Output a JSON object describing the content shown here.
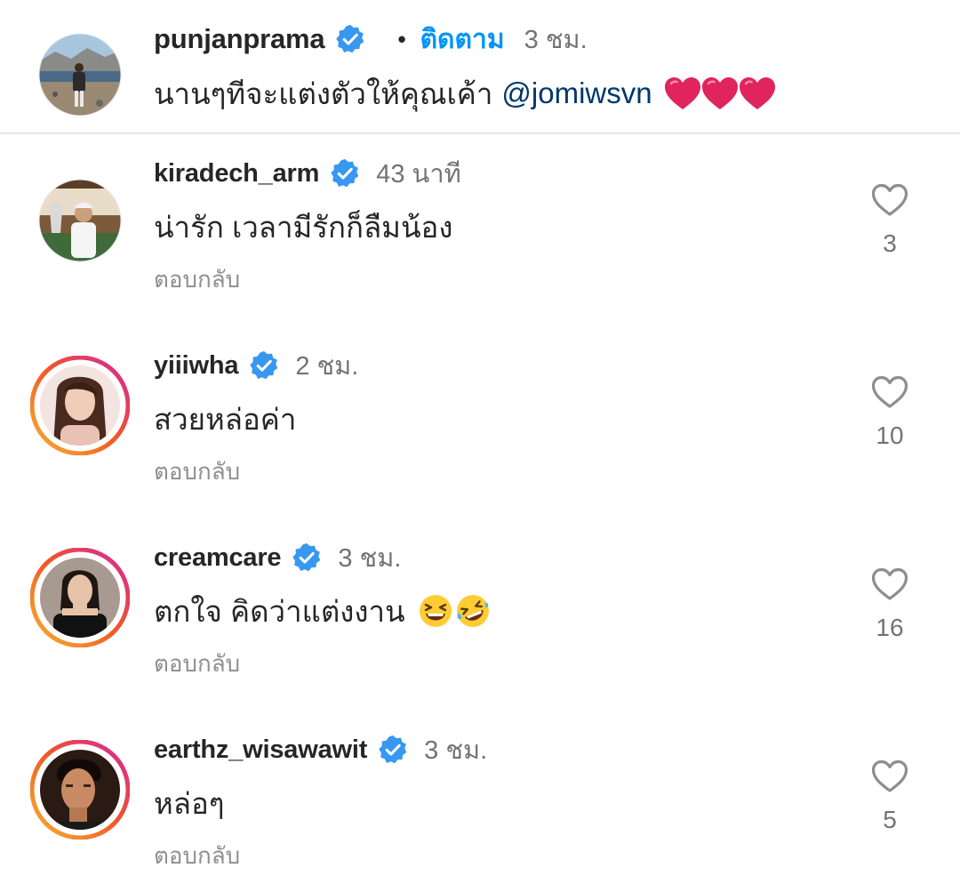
{
  "caption": {
    "username": "punjanprama",
    "dot": "•",
    "follow_label": "ติดตาม",
    "time": "3 ชม.",
    "text": "นานๆทีจะแต่งตัวให้คุณเค้า",
    "mention": "@jomiwsvn"
  },
  "comments": [
    {
      "username": "kiradech_arm",
      "time": "43 นาที",
      "text": "น่ารัก เวลามีรักก็ลืมน้อง",
      "reply": "ตอบกลับ",
      "likes": "3"
    },
    {
      "username": "yiiiwha",
      "time": "2 ชม.",
      "text": "สวยหล่อค่า",
      "reply": "ตอบกลับ",
      "likes": "10"
    },
    {
      "username": "creamcare",
      "time": "3 ชม.",
      "text": "ตกใจ คิดว่าแต่งงาน",
      "reply": "ตอบกลับ",
      "likes": "16"
    },
    {
      "username": "earthz_wisawawit",
      "time": "3 ชม.",
      "text": "หล่อๆ",
      "reply": "ตอบกลับ",
      "likes": "5"
    }
  ],
  "colors": {
    "verified": "#3897f0",
    "follow": "#0095f6",
    "heart": "#e0245e",
    "story_ring_start": "#f9b233",
    "story_ring_end": "#d6249f"
  }
}
